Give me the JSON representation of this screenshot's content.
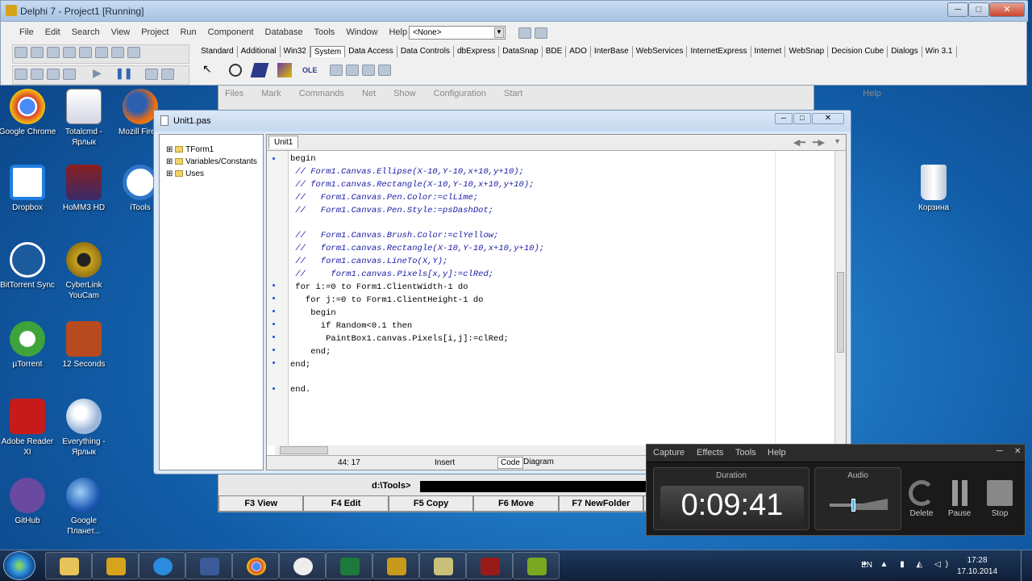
{
  "ide": {
    "title": "Delphi 7 - Project1 [Running]",
    "menu": [
      "File",
      "Edit",
      "Search",
      "View",
      "Project",
      "Run",
      "Component",
      "Database",
      "Tools",
      "Window",
      "Help"
    ],
    "config_combo": "<None>",
    "palette_tabs": [
      "Standard",
      "Additional",
      "Win32",
      "System",
      "Data Access",
      "Data Controls",
      "dbExpress",
      "DataSnap",
      "BDE",
      "ADO",
      "InterBase",
      "WebServices",
      "InternetExpress",
      "Internet",
      "WebSnap",
      "Decision Cube",
      "Dialogs",
      "Win 3.1"
    ],
    "palette_active": "System"
  },
  "desktop": {
    "icons": [
      {
        "label": "Google Chrome",
        "color": "#d9412f"
      },
      {
        "label": "Totalcmd - Ярлык",
        "color": "#c8c8d8"
      },
      {
        "label": "Mozill Firefo",
        "color": "#e66a17"
      },
      {
        "label": "Dropbox",
        "color": "#1f7ee0"
      },
      {
        "label": "HoMM3 HD",
        "color": "#8a1f1f"
      },
      {
        "label": "iTools",
        "color": "#2f76c8"
      },
      {
        "label": "BitTorrent Sync",
        "color": "#1c5a9e"
      },
      {
        "label": "CyberLink YouCam",
        "color": "#c9a21c"
      },
      {
        "label": "µTorrent",
        "color": "#3da33a"
      },
      {
        "label": "12 Seconds",
        "color": "#b84a20"
      },
      {
        "label": "Adobe Reader XI",
        "color": "#c71b1b"
      },
      {
        "label": "Everything - Ярлык",
        "color": "#9bb6d9"
      },
      {
        "label": "GitHub",
        "color": "#6a4aa0"
      },
      {
        "label": "Google Планет...",
        "color": "#1d5ab5"
      }
    ],
    "recycle_bin": "Корзина"
  },
  "totalcmd": {
    "path": "d:\\Tools>",
    "menu": [
      "Files",
      "Mark",
      "Commands",
      "Net",
      "Show",
      "Configuration",
      "Start",
      "Help"
    ],
    "fkeys": [
      "F3 View",
      "F4 Edit",
      "F5 Copy",
      "F6 Move",
      "F7 NewFolder"
    ]
  },
  "unit_window": {
    "title": "Unit1.pas",
    "tree": [
      "TForm1",
      "Variables/Constants",
      "Uses"
    ],
    "tab": "Unit1",
    "code": [
      {
        "text": "begin",
        "c": false
      },
      {
        "text": " // Form1.Canvas.Ellipse(X-10,Y-10,x+10,y+10);",
        "c": true
      },
      {
        "text": " // form1.canvas.Rectangle(X-10,Y-10,x+10,y+10);",
        "c": true
      },
      {
        "text": " //   Form1.Canvas.Pen.Color:=clLime;",
        "c": true
      },
      {
        "text": " //   Form1.Canvas.Pen.Style:=psDashDot;",
        "c": true
      },
      {
        "text": "",
        "c": false
      },
      {
        "text": " //   Form1.Canvas.Brush.Color:=clYellow;",
        "c": true
      },
      {
        "text": " //   form1.canvas.Rectangle(X-10,Y-10,x+10,y+10);",
        "c": true
      },
      {
        "text": " //   form1.canvas.LineTo(X,Y);",
        "c": true
      },
      {
        "text": " //     form1.canvas.Pixels[x,y]:=clRed;",
        "c": true
      },
      {
        "text": " for i:=0 to Form1.ClientWidth-1 do",
        "c": false
      },
      {
        "text": "   for j:=0 to Form1.ClientHeight-1 do",
        "c": false
      },
      {
        "text": "    begin",
        "c": false
      },
      {
        "text": "      if Random<0.1 then",
        "c": false
      },
      {
        "text": "       PaintBox1.canvas.Pixels[i,j]:=clRed;",
        "c": false
      },
      {
        "text": "    end;",
        "c": false
      },
      {
        "text": "end;",
        "c": false
      },
      {
        "text": "",
        "c": false
      },
      {
        "text": "end.",
        "c": false
      }
    ],
    "status_pos": "44: 17",
    "status_mode": "Insert",
    "tab_code": "Code",
    "tab_diagram": "Diagram"
  },
  "recorder": {
    "menu": [
      "Capture",
      "Effects",
      "Tools",
      "Help"
    ],
    "duration_label": "Duration",
    "duration": "0:09:41",
    "audio_label": "Audio",
    "audio_level": 0.4,
    "buttons": [
      "Delete",
      "Pause",
      "Stop"
    ]
  },
  "taskbar": {
    "lang": "EN",
    "time": "17:28",
    "date": "17.10.2014",
    "apps": [
      "explorer",
      "delphi",
      "ie",
      "save",
      "chrome",
      "app-bird",
      "excel",
      "delphi7a",
      "folder",
      "recorder",
      "delphi7b"
    ]
  }
}
